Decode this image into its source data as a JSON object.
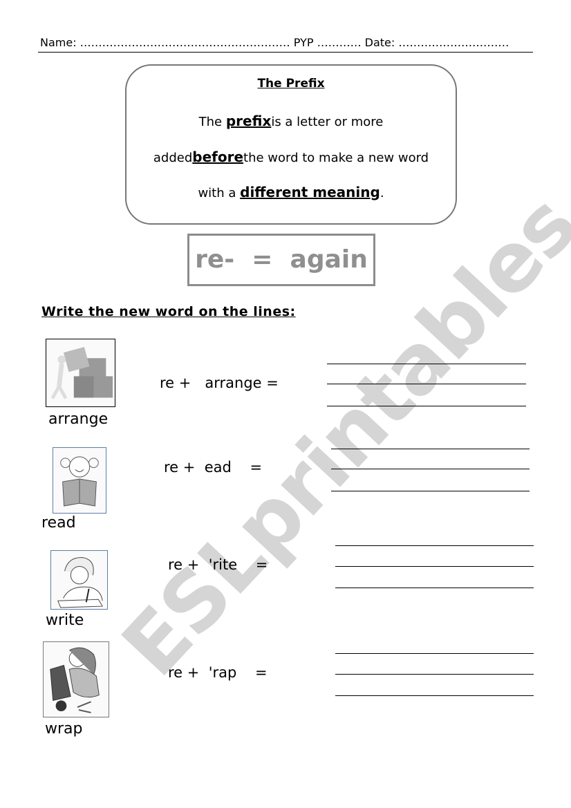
{
  "header": {
    "name_label": "Name: ………………………………………………… PYP ………… Date: …………………………"
  },
  "info_box": {
    "title": "The Prefix",
    "line1_pre": "The ",
    "line1_bold": "prefix",
    "line1_post": "is a letter or more",
    "line2_pre": "added",
    "line2_bold": "before",
    "line2_post": "the word to make a new word",
    "line3_pre": "with a ",
    "line3_bold": "different meaning",
    "line3_post": "."
  },
  "rule": {
    "text": "re-  =  again"
  },
  "instructions": "Write the new word on the lines:",
  "exercises": [
    {
      "word": "arrange",
      "equation": "re +   arrange =",
      "picture": "person-stacking-boxes"
    },
    {
      "word": "read",
      "equation": "re +  ead    =",
      "picture": "girl-reading-book"
    },
    {
      "word": "write",
      "equation": "re +  'rite    =",
      "picture": "girl-writing"
    },
    {
      "word": "wrap",
      "equation": "re +  'rap    =",
      "picture": "girl-wrapping-gift"
    }
  ],
  "watermark": "ESLprintables.com"
}
